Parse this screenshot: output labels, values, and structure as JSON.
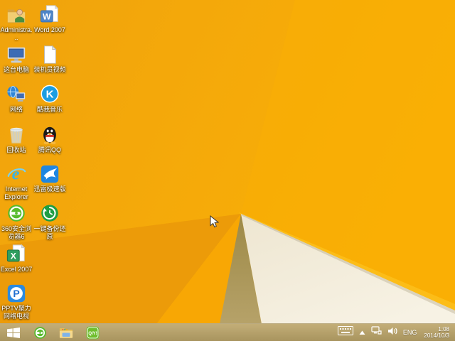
{
  "wallpaper": {
    "base_left": "#f0a30d",
    "base_right": "#fab006",
    "dark_wedge": "#ec9b09",
    "bright_wedge": "#f8a704",
    "khaki_wedge": "#a9944f",
    "white_wedge": "#f2ebd9",
    "fold_edge": "#fcbd18"
  },
  "desktop": {
    "icons": [
      {
        "id": "admin-folder",
        "label": "Administra..."
      },
      {
        "id": "word-2007",
        "label": "Word 2007",
        "glyph": "W"
      },
      {
        "id": "this-pc",
        "label": "这台电脑"
      },
      {
        "id": "video-file",
        "label": "装机员视频"
      },
      {
        "id": "network",
        "label": "网络"
      },
      {
        "id": "kuwo-music",
        "label": "酷我音乐",
        "glyph": "K"
      },
      {
        "id": "recycle-bin",
        "label": "回收站"
      },
      {
        "id": "tencent-qq",
        "label": "腾讯QQ"
      },
      {
        "id": "internet-explorer",
        "label": "Internet Explorer",
        "glyph": "e"
      },
      {
        "id": "xunlei",
        "label": "迅雷极速版"
      },
      {
        "id": "360-browser",
        "label": "360安全浏览器6"
      },
      {
        "id": "backup-restore",
        "label": "一键备份还原"
      },
      {
        "id": "excel-2007",
        "label": "Excel 2007",
        "glyph": "X"
      },
      {
        "id": "pptv",
        "label": "PPTV聚力 网络电视",
        "glyph": "P"
      }
    ]
  },
  "taskbar": {
    "apps": [
      {
        "name": "start"
      },
      {
        "name": "360-browser"
      },
      {
        "name": "file-explorer"
      },
      {
        "name": "iqiyi",
        "badge": "QIY!"
      }
    ],
    "tray": {
      "language": "ENG",
      "time": "1:08",
      "date": "2014/10/3"
    }
  }
}
